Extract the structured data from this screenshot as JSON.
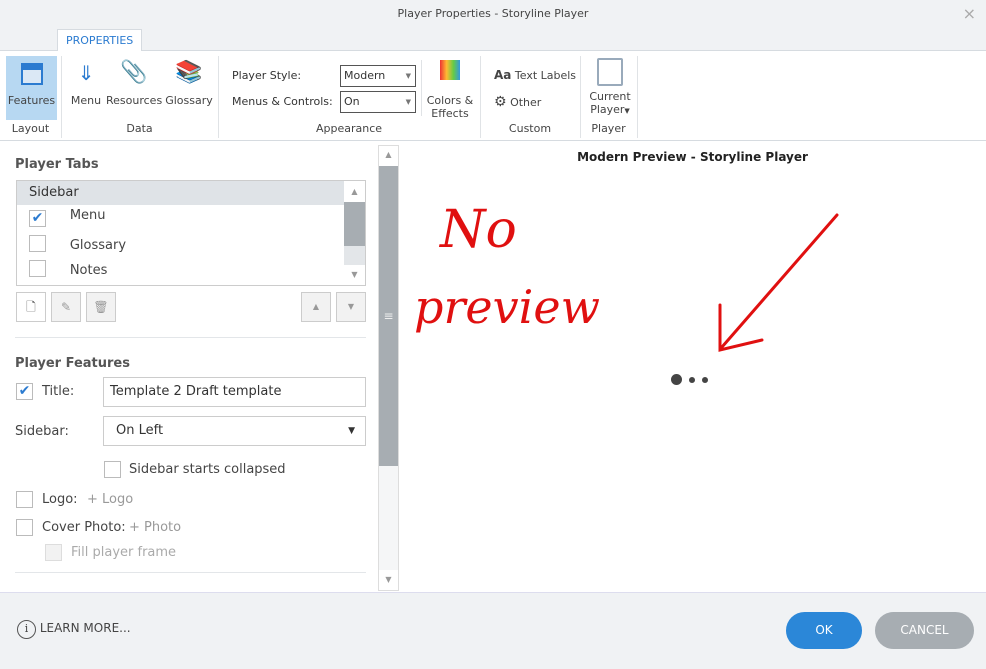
{
  "window": {
    "title": "Player Properties - Storyline Player",
    "close": "×"
  },
  "ribbon": {
    "tab": "PROPERTIES",
    "features": "Features",
    "layout_group": "Layout",
    "menu": "Menu",
    "resources": "Resources",
    "glossary": "Glossary",
    "data_group": "Data",
    "player_style_label": "Player Style:",
    "player_style_value": "Modern",
    "menus_controls_label": "Menus & Controls:",
    "menus_controls_value": "On",
    "colors_effects_1": "Colors &",
    "colors_effects_2": "Effects",
    "appearance_group": "Appearance",
    "text_labels_prefix": "Aa",
    "text_labels": "Text Labels",
    "other": "Other",
    "custom_group": "Custom",
    "current_player_1": "Current",
    "current_player_2": "Player",
    "player_group": "Player"
  },
  "player_tabs": {
    "heading": "Player Tabs",
    "group": "Sidebar",
    "items": [
      {
        "label": "Menu",
        "checked": true
      },
      {
        "label": "Glossary",
        "checked": false
      },
      {
        "label": "Notes",
        "checked": false
      }
    ]
  },
  "player_features": {
    "heading": "Player Features",
    "title_label": "Title:",
    "title_checked": true,
    "title_value": "Template 2 Draft template",
    "sidebar_label": "Sidebar:",
    "sidebar_value": "On Left",
    "sidebar_collapsed": "Sidebar starts collapsed",
    "logo_label": "Logo:",
    "logo_add": "+ Logo",
    "cover_label": "Cover Photo:",
    "cover_add": "+ Photo",
    "fill_frame": "Fill player frame"
  },
  "preview": {
    "title": "Modern Preview - Storyline Player",
    "annotation_1": "No",
    "annotation_2": "preview"
  },
  "footer": {
    "learn_more": "LEARN MORE...",
    "ok": "OK",
    "cancel": "CANCEL"
  },
  "colors": {
    "accent": "#2b7bd0",
    "ok": "#2b87d8",
    "cancel": "#a7adb2",
    "annotation": "#e01010"
  }
}
